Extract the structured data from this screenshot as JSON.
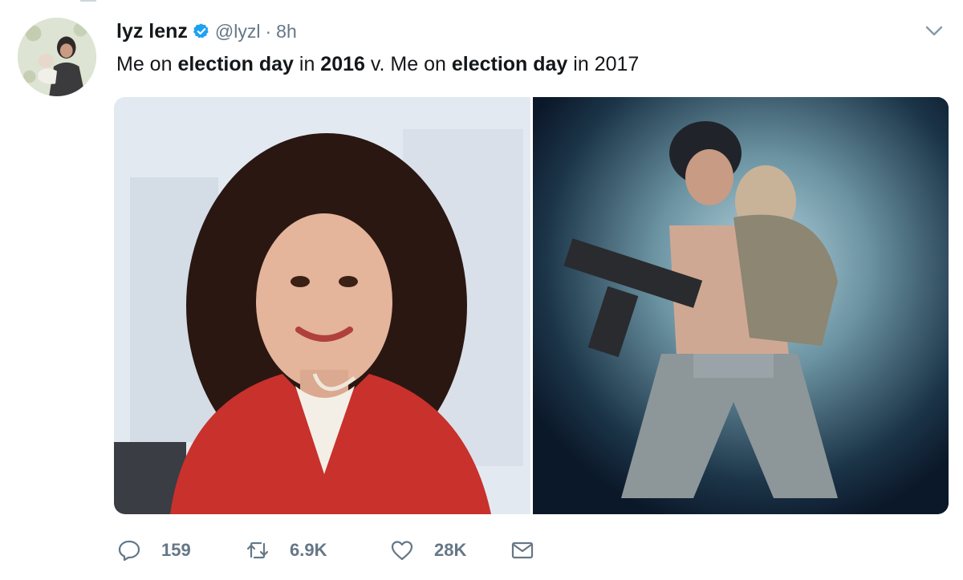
{
  "tweet": {
    "display_name": "lyz lenz",
    "handle": "@lyzl",
    "separator": "·",
    "timestamp": "8h",
    "text_segments": [
      {
        "text": "Me on ",
        "bold": false
      },
      {
        "text": "election day",
        "bold": true
      },
      {
        "text": " in ",
        "bold": false
      },
      {
        "text": "2016",
        "bold": true
      },
      {
        "text": " v. Me on ",
        "bold": false
      },
      {
        "text": "election day",
        "bold": true
      },
      {
        "text": " in 2017",
        "bold": false
      }
    ]
  },
  "actions": {
    "replies": "159",
    "retweets": "6.9K",
    "likes": "28K"
  },
  "icons": {
    "verified": "verified-badge-icon",
    "menu": "chevron-down-icon",
    "reply": "reply-icon",
    "retweet": "retweet-icon",
    "like": "heart-icon",
    "message": "envelope-icon"
  },
  "colors": {
    "text": "#14171a",
    "secondary": "#657786",
    "verified_blue": "#1da1f2"
  }
}
